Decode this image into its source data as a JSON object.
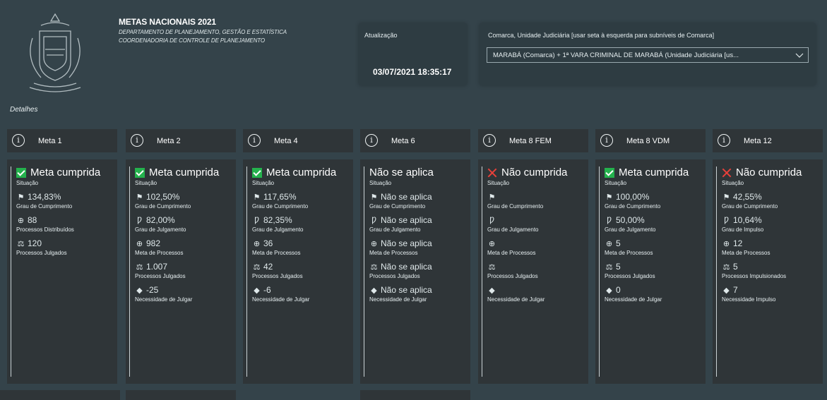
{
  "header": {
    "title": "METAS NACIONAIS 2021",
    "subtitle1": "DEPARTAMENTO DE PLANEJAMENTO, GESTÃO E ESTATÍSTICA",
    "subtitle2": "COORDENADORIA DE CONTROLE DE PLANEJAMENTO",
    "detalhes": "Detalhes"
  },
  "update": {
    "label": "Atualização",
    "value": "03/07/2021 18:35:17"
  },
  "filter": {
    "label": "Comarca, Unidade Judiciária [usar seta à esquerda para subníveis de Comarca]",
    "selected": "MARABÁ (Comarca) + 1ª VARA CRIMINAL DE MARABÁ (Unidade Judiciária [us...",
    "chevron_icon": "chevron-down-icon"
  },
  "colors": {
    "background": "#34434a",
    "card": "#2f3538",
    "ok": "#24b24d",
    "fail": "#e8403a"
  },
  "metas": [
    {
      "label": "Meta 1",
      "status": "ok",
      "situacao": "Meta cumprida",
      "situacao_label": "Situação",
      "items": [
        {
          "icon": "flag-icon",
          "value": "134,83%",
          "label": "Grau de Cumprimento"
        },
        {
          "icon": "globe-icon",
          "value": "88",
          "label": "Processos Distribuídos"
        },
        {
          "icon": "gavel-icon",
          "value": "120",
          "label": "Processos Julgados"
        }
      ]
    },
    {
      "label": "Meta 2",
      "status": "ok",
      "situacao": "Meta cumprida",
      "situacao_label": "Situação",
      "items": [
        {
          "icon": "flag-icon",
          "value": "102,50%",
          "label": "Grau de Cumprimento"
        },
        {
          "icon": "p-icon",
          "value": "82,00%",
          "label": "Grau de Julgamento"
        },
        {
          "icon": "globe-icon",
          "value": "982",
          "label": "Meta de Processos"
        },
        {
          "icon": "gavel-icon",
          "value": "1.007",
          "label": "Processos Julgados"
        },
        {
          "icon": "diamond-icon",
          "value": "-25",
          "label": "Necessidade de Julgar"
        }
      ]
    },
    {
      "label": "Meta 4",
      "status": "ok",
      "situacao": "Meta cumprida",
      "situacao_label": "Situação",
      "items": [
        {
          "icon": "flag-icon",
          "value": "117,65%",
          "label": "Grau de Cumprimento"
        },
        {
          "icon": "p-icon",
          "value": "82,35%",
          "label": "Grau de Julgamento"
        },
        {
          "icon": "globe-icon",
          "value": "36",
          "label": "Meta de Processos"
        },
        {
          "icon": "gavel-icon",
          "value": "42",
          "label": "Processos Julgados"
        },
        {
          "icon": "diamond-icon",
          "value": "-6",
          "label": "Necessidade de Julgar"
        }
      ]
    },
    {
      "label": "Meta 6",
      "status": "na",
      "situacao": "Não se aplica",
      "situacao_label": "Situação",
      "items": [
        {
          "icon": "flag-icon",
          "value": "Não se aplica",
          "label": "Grau de Cumprimento"
        },
        {
          "icon": "p-icon",
          "value": "Não se aplica",
          "label": "Grau de Julgamento"
        },
        {
          "icon": "globe-icon",
          "value": "Não se aplica",
          "label": "Meta de Processos"
        },
        {
          "icon": "gavel-icon",
          "value": "Não se aplica",
          "label": "Processos Julgados"
        },
        {
          "icon": "diamond-icon",
          "value": "Não se aplica",
          "label": "Necessidade de Julgar"
        }
      ]
    },
    {
      "label": "Meta 8 FEM",
      "status": "fail",
      "situacao": "Não cumprida",
      "situacao_label": "Situação",
      "items": [
        {
          "icon": "flag-icon",
          "value": "",
          "label": "Grau de Cumprimento"
        },
        {
          "icon": "p-icon",
          "value": "",
          "label": "Grau de Julgamento"
        },
        {
          "icon": "globe-icon",
          "value": "",
          "label": "Meta de Processos"
        },
        {
          "icon": "gavel-icon",
          "value": "",
          "label": "Processos Julgados"
        },
        {
          "icon": "diamond-icon",
          "value": "",
          "label": "Necessidade de Julgar"
        }
      ]
    },
    {
      "label": "Meta 8 VDM",
      "status": "ok",
      "situacao": "Meta cumprida",
      "situacao_label": "Situação",
      "items": [
        {
          "icon": "flag-icon",
          "value": "100,00%",
          "label": "Grau de Cumprimento"
        },
        {
          "icon": "p-icon",
          "value": "50,00%",
          "label": "Grau de Julgamento"
        },
        {
          "icon": "globe-icon",
          "value": "5",
          "label": "Meta de Processos"
        },
        {
          "icon": "gavel-icon",
          "value": "5",
          "label": "Processos Julgados"
        },
        {
          "icon": "diamond-icon",
          "value": "0",
          "label": "Necessidade de Julgar"
        }
      ]
    },
    {
      "label": "Meta 12",
      "status": "fail",
      "situacao": "Não cumprida",
      "situacao_label": "Situação",
      "items": [
        {
          "icon": "flag-icon",
          "value": "42,55%",
          "label": "Grau de Cumprimento"
        },
        {
          "icon": "p-icon",
          "value": "10,64%",
          "label": "Grau de Impulso"
        },
        {
          "icon": "globe-icon",
          "value": "12",
          "label": "Meta de Processos"
        },
        {
          "icon": "gavel-icon",
          "value": "5",
          "label": "Processos Impulsionados"
        },
        {
          "icon": "diamond-icon",
          "value": "7",
          "label": "Necessidade Impulso"
        }
      ]
    }
  ]
}
